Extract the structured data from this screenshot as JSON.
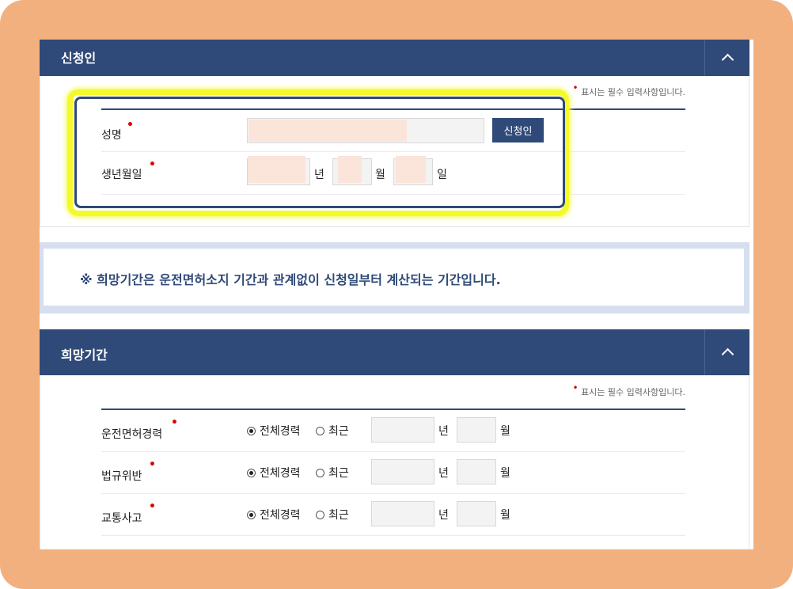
{
  "applicant": {
    "title": "신청인",
    "required_note": "표시는 필수 입력사항입니다.",
    "name_label": "성명",
    "name_button": "신청인",
    "birth_label": "생년월일",
    "year_unit": "년",
    "month_unit": "월",
    "day_unit": "일"
  },
  "notice": "※ 희망기간은 운전면허소지 기간과 관계없이 신청일부터 계산되는 기간입니다.",
  "period": {
    "title": "희망기간",
    "required_note": "표시는 필수 입력사항입니다.",
    "rows": [
      {
        "label": "운전면허경력",
        "opt_all": "전체경력",
        "opt_recent": "최근",
        "year_unit": "년",
        "month_unit": "월"
      },
      {
        "label": "법규위반",
        "opt_all": "전체경력",
        "opt_recent": "최근",
        "year_unit": "년",
        "month_unit": "월"
      },
      {
        "label": "교통사고",
        "opt_all": "전체경력",
        "opt_recent": "최근",
        "year_unit": "년",
        "month_unit": "월"
      }
    ]
  },
  "colors": {
    "navy": "#2f4a78",
    "highlight": "#f4f92a",
    "frame": "#f3b07f",
    "required": "#e00000"
  }
}
